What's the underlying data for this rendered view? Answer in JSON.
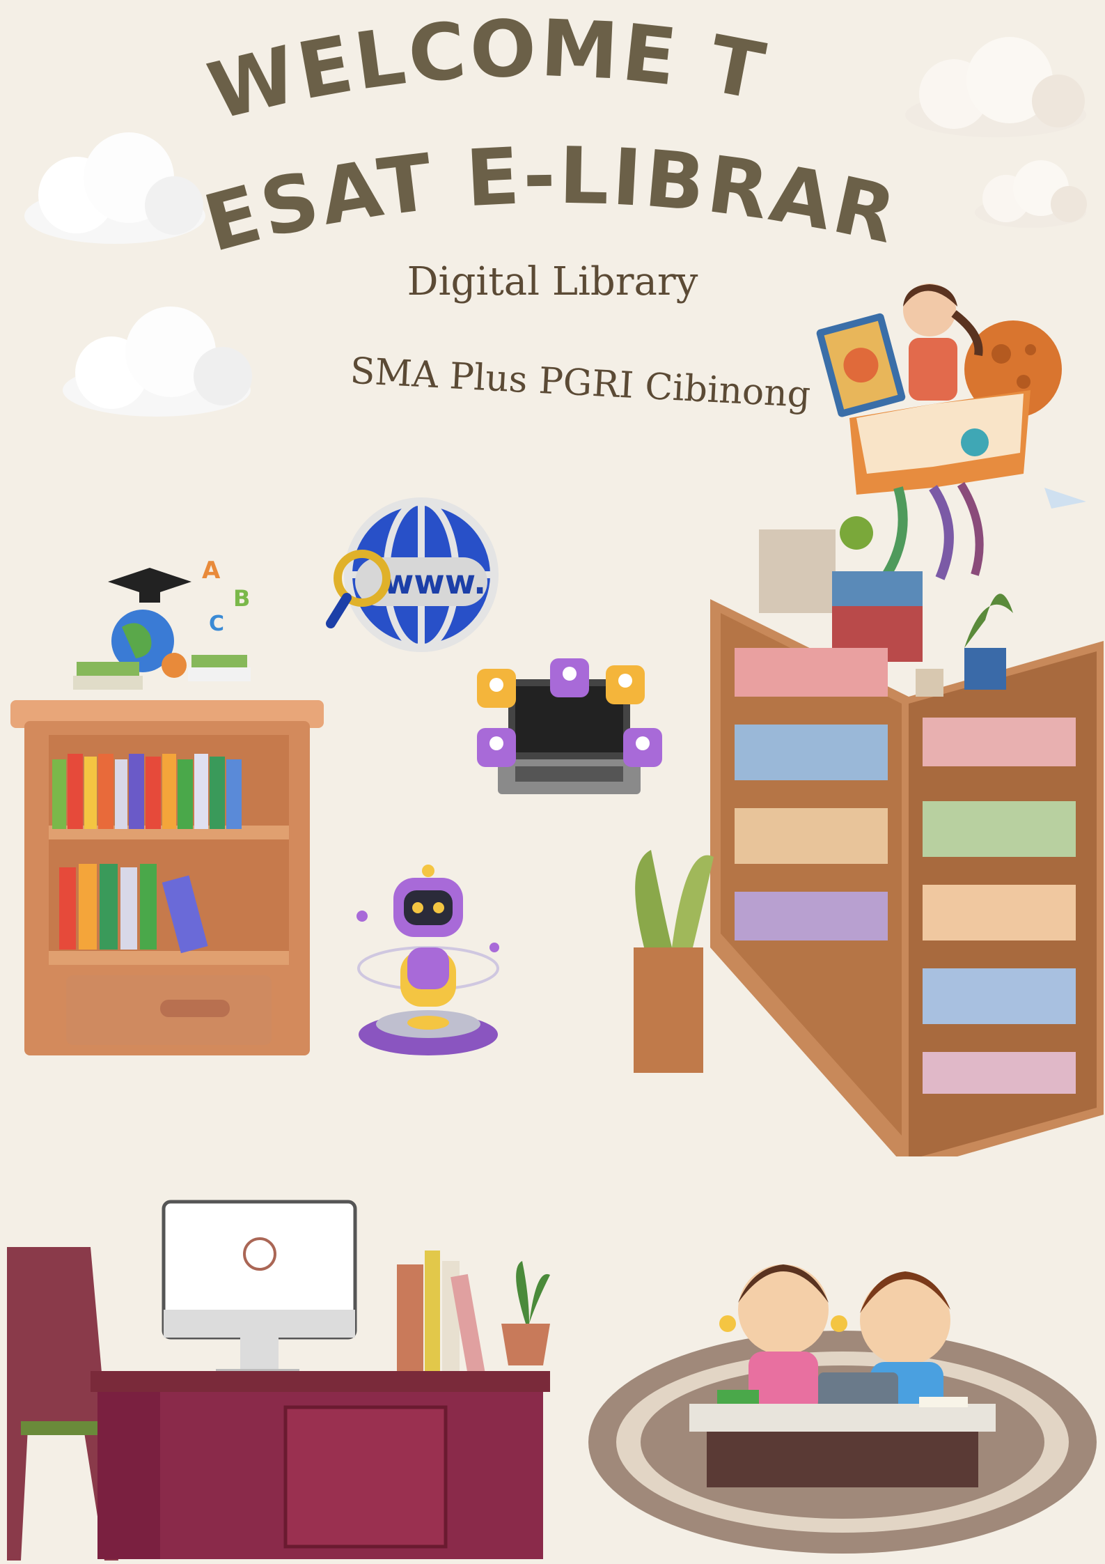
{
  "poster": {
    "title_line1": "WELCOME TO",
    "title_line2": "PESAT E-LIBRARY",
    "subtitle": "Digital Library",
    "school": "SMA Plus PGRI Cibinong",
    "colors": {
      "background": "#f4efe6",
      "title": "#6b6048",
      "text": "#5b4a35"
    }
  },
  "illustrations": {
    "globe_badge": "www.",
    "cap_letters": [
      "A",
      "B",
      "C"
    ]
  }
}
